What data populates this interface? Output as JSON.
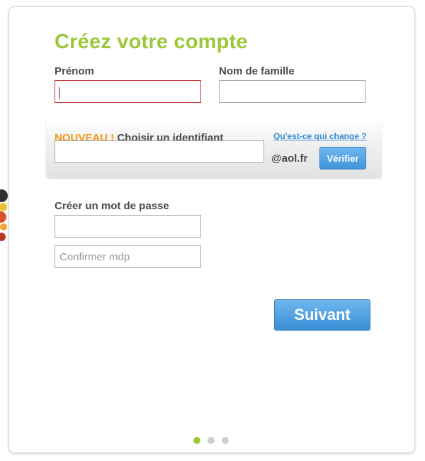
{
  "form": {
    "title": "Créez votre compte",
    "first_name": {
      "label": "Prénom",
      "value": ""
    },
    "last_name": {
      "label": "Nom de famille",
      "value": ""
    },
    "identifier": {
      "new_badge": "NOUVEAU !",
      "label": "Choisir un identifiant",
      "what_changes_link": "Qu'est-ce qui change ?",
      "value": "",
      "domain": "@aol.fr",
      "verify_button": "Vérifier"
    },
    "password": {
      "label": "Créer un mot de passe",
      "value": "",
      "confirm_placeholder": "Confirmer mdp"
    },
    "next_button": "Suivant"
  },
  "pagination": {
    "total_steps": 3,
    "current_step": 1
  },
  "colors": {
    "title_green": "#9dc73b",
    "new_orange": "#f29b1d",
    "link_blue": "#3a8fd6",
    "button_blue": "#3f95db",
    "error_red": "#c23b3b"
  }
}
